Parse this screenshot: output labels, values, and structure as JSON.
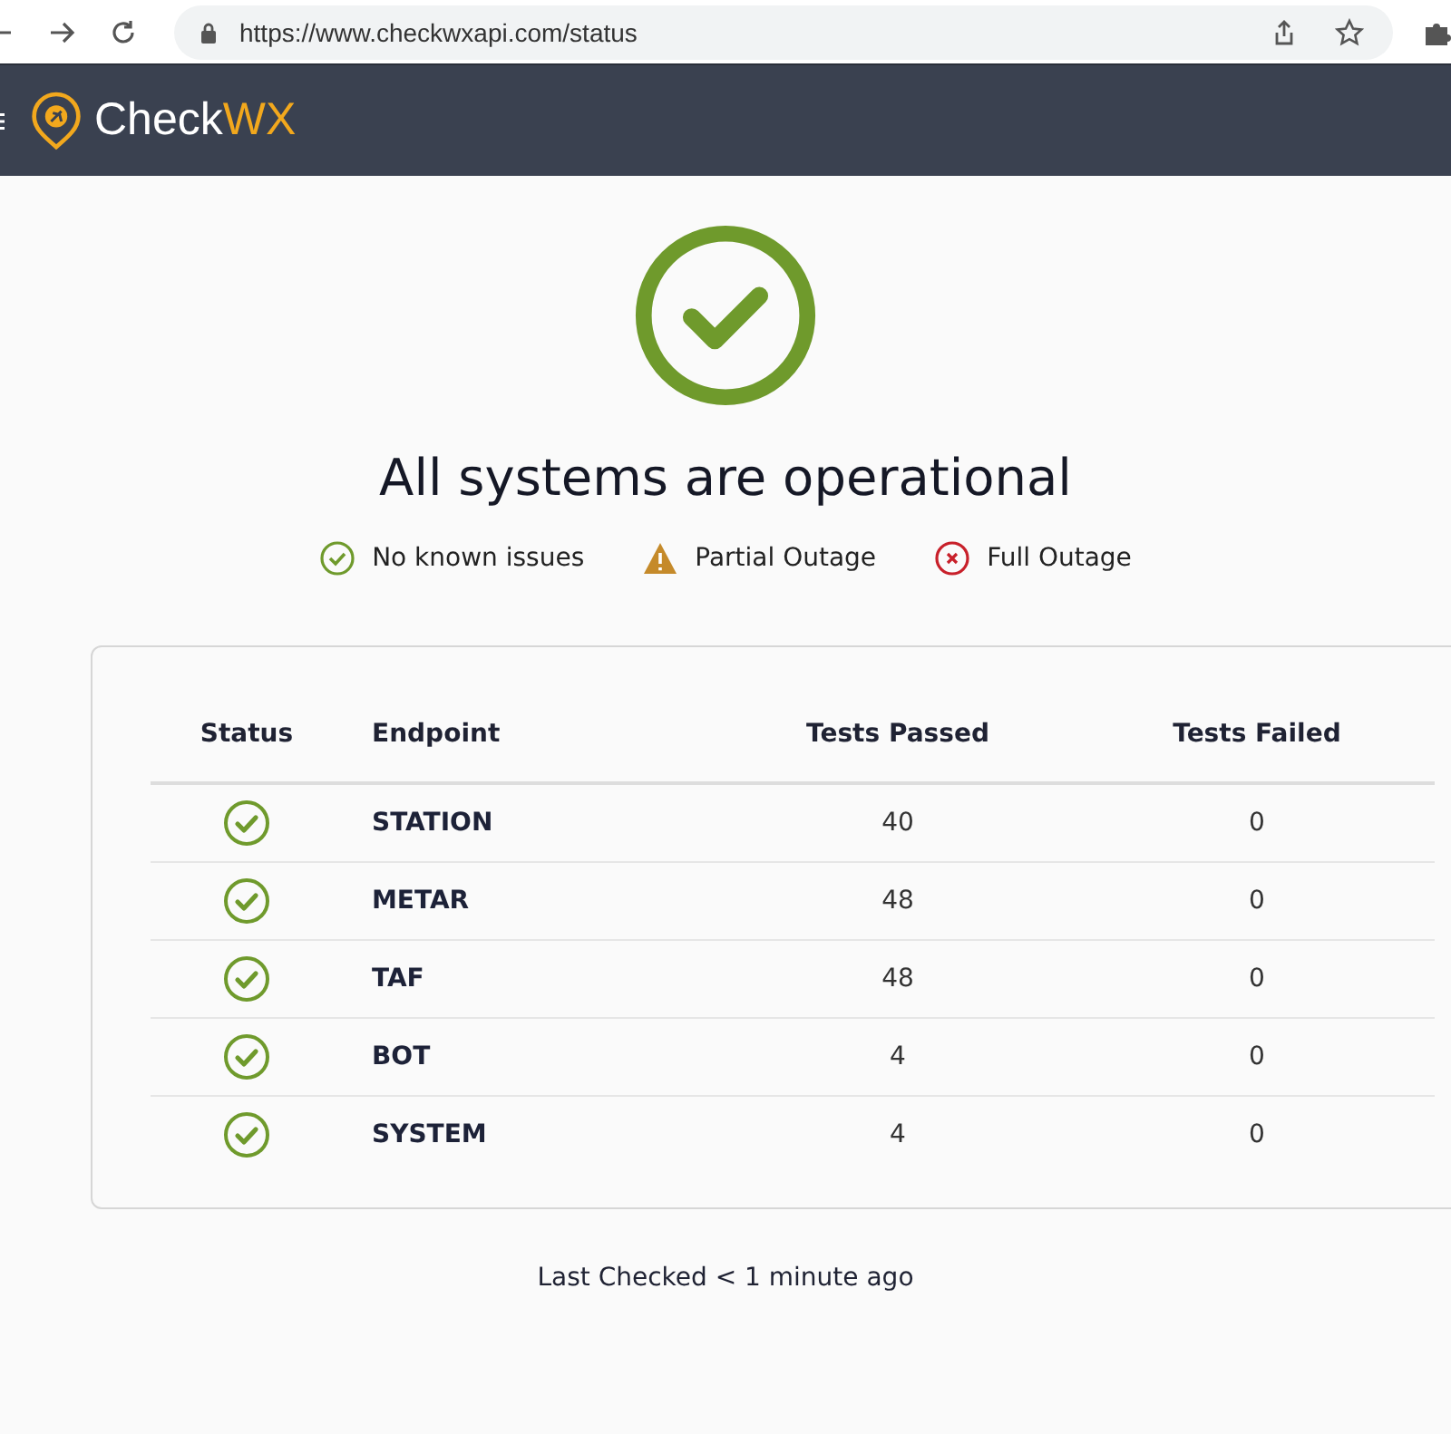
{
  "browser": {
    "url": "https://www.checkwxapi.com/status"
  },
  "header": {
    "brand": "Check",
    "brand_accent": "WX"
  },
  "overall": {
    "kind": "ok",
    "title": "All systems are operational"
  },
  "legend": [
    {
      "kind": "ok",
      "label": "No known issues"
    },
    {
      "kind": "partial",
      "label": "Partial Outage"
    },
    {
      "kind": "outage",
      "label": "Full Outage"
    }
  ],
  "table": {
    "columns": [
      "Status",
      "Endpoint",
      "Tests Passed",
      "Tests Failed"
    ],
    "rows": [
      {
        "kind": "ok",
        "endpoint": "STATION",
        "passed": "40",
        "failed": "0"
      },
      {
        "kind": "ok",
        "endpoint": "METAR",
        "passed": "48",
        "failed": "0"
      },
      {
        "kind": "ok",
        "endpoint": "TAF",
        "passed": "48",
        "failed": "0"
      },
      {
        "kind": "ok",
        "endpoint": "BOT",
        "passed": "4",
        "failed": "0"
      },
      {
        "kind": "ok",
        "endpoint": "SYSTEM",
        "passed": "4",
        "failed": "0"
      }
    ]
  },
  "footer": "Last Checked < 1 minute ago"
}
